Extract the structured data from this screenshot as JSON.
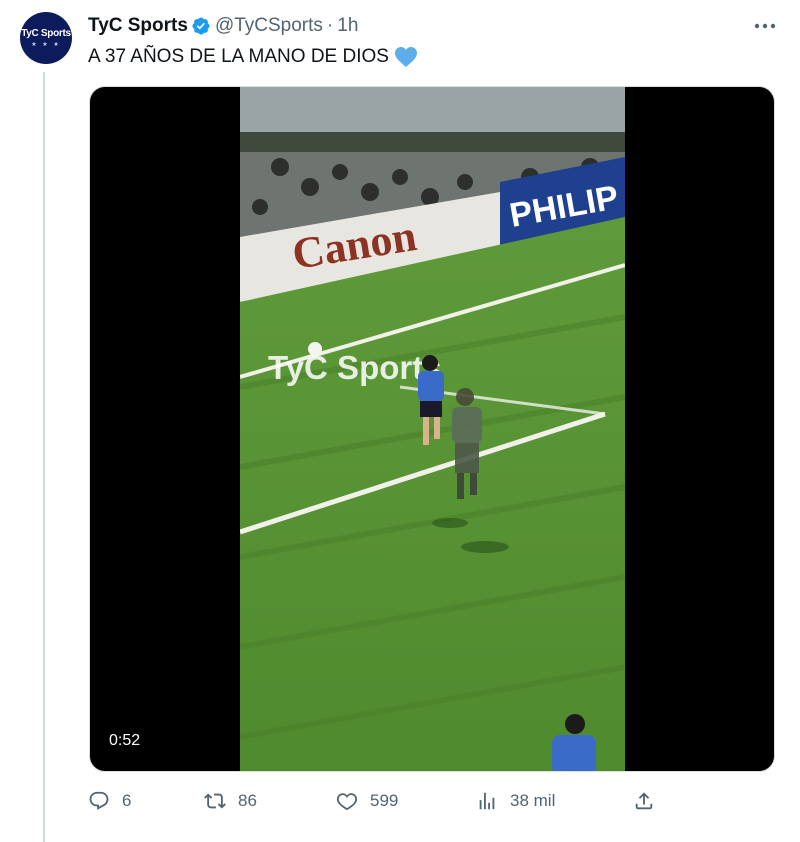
{
  "account": {
    "display_name": "TyC Sports",
    "handle": "@TyCSports",
    "separator": "·",
    "time": "1h",
    "avatar_text": "TyC Sports",
    "avatar_stars": "★ ★ ★",
    "verified_color": "#1d9bf0"
  },
  "tweet": {
    "text": "A 37 AÑOS DE LA MANO DE DIOS",
    "emoji": "blue-heart-icon"
  },
  "media": {
    "duration": "0:52",
    "watermark": "TyC Sports",
    "ad_boards": [
      "Canon",
      "PHILIP"
    ]
  },
  "actions": {
    "replies": "6",
    "retweets": "86",
    "likes": "599",
    "views": "38 mil",
    "icons": [
      "reply-icon",
      "retweet-icon",
      "like-icon",
      "views-icon",
      "share-icon"
    ]
  },
  "colors": {
    "muted": "#536471",
    "brand_blue": "#1d9bf0",
    "avatar_bg": "#0b1b5c"
  }
}
